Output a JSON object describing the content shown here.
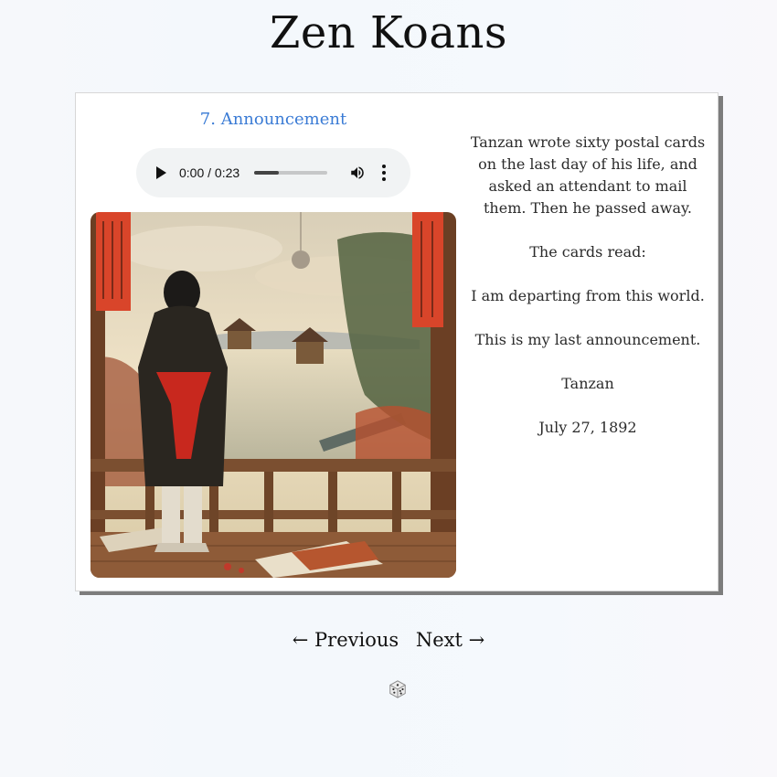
{
  "site": {
    "title": "Zen Koans"
  },
  "koan": {
    "title": "7. Announcement",
    "audio": {
      "time": "0:00 / 0:23",
      "progress": 0.33
    },
    "paragraphs": [
      "Tanzan wrote sixty postal cards on the last day of his life, and asked an attendant to mail them. Then he passed away.",
      "The cards read:",
      "I am departing from this world.",
      "This is my last announcement.",
      "Tanzan",
      "July 27, 1892"
    ],
    "image": {
      "icon": "illustration-man-on-balcony"
    }
  },
  "nav": {
    "previous": "← Previous",
    "next": "Next →",
    "random_icon": "dice-icon"
  }
}
